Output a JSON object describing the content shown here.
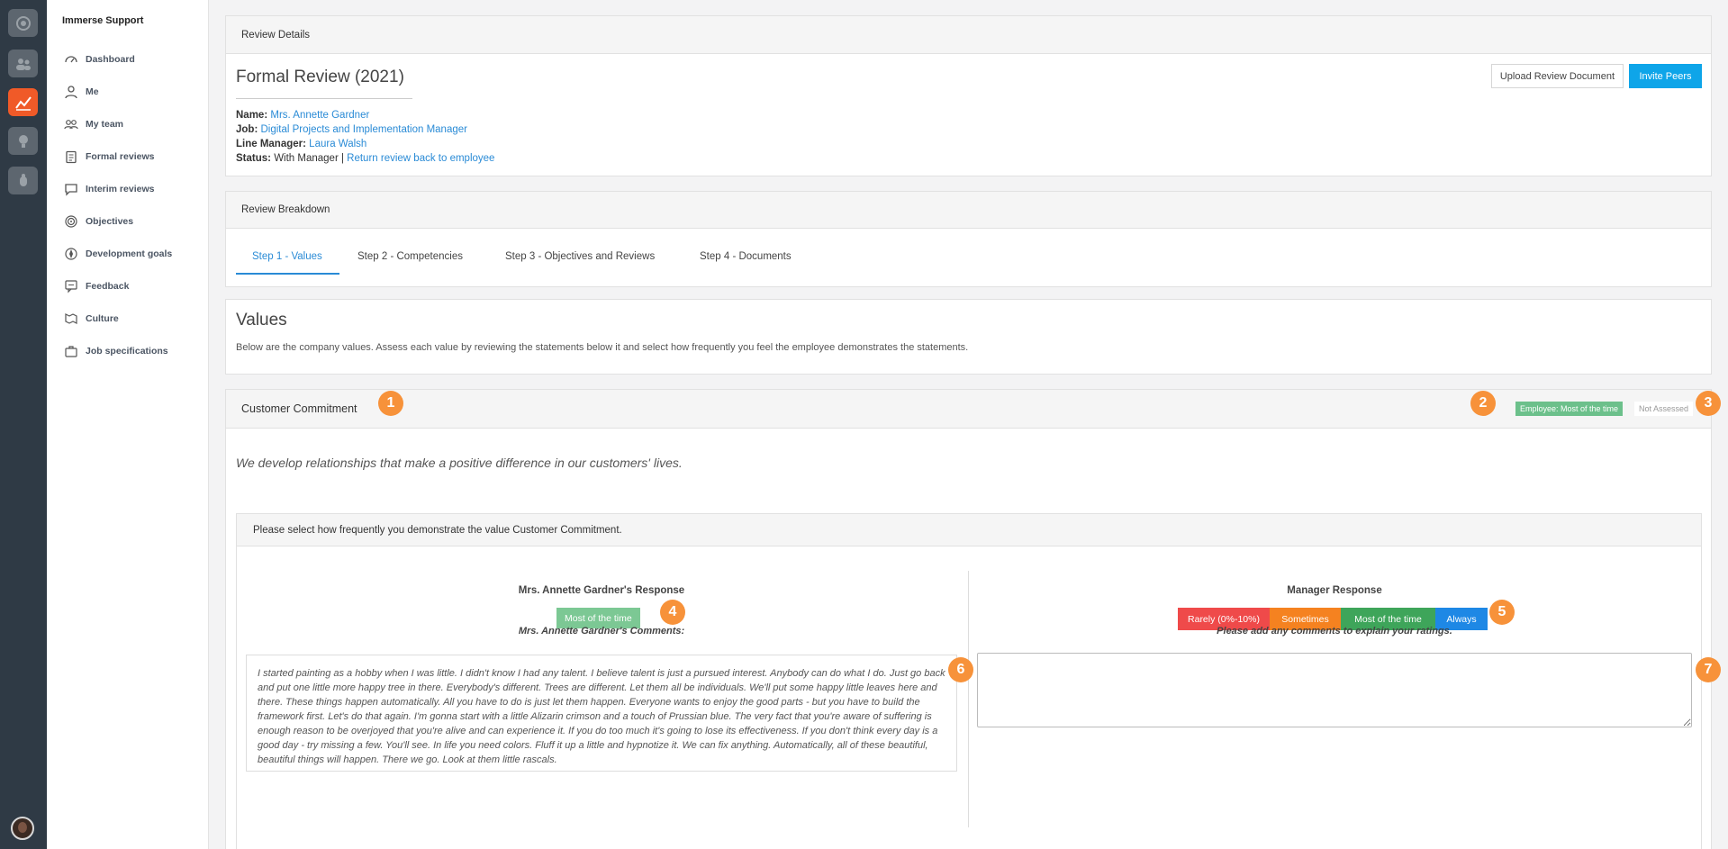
{
  "sidebar": {
    "brand": "Immerse Support",
    "items": [
      {
        "label": "Dashboard",
        "icon": "dashboard-icon"
      },
      {
        "label": "Me",
        "icon": "person-icon"
      },
      {
        "label": "My team",
        "icon": "team-icon"
      },
      {
        "label": "Formal reviews",
        "icon": "clipboard-icon"
      },
      {
        "label": "Interim reviews",
        "icon": "chat-icon"
      },
      {
        "label": "Objectives",
        "icon": "target-icon"
      },
      {
        "label": "Development goals",
        "icon": "compass-icon"
      },
      {
        "label": "Feedback",
        "icon": "feedback-icon"
      },
      {
        "label": "Culture",
        "icon": "culture-icon"
      },
      {
        "label": "Job specifications",
        "icon": "briefcase-icon"
      }
    ]
  },
  "review_details": {
    "header": "Review Details",
    "title": "Formal Review (2021)",
    "upload_label": "Upload Review Document",
    "invite_label": "Invite Peers",
    "name_label": "Name:",
    "name_value": "Mrs. Annette Gardner",
    "job_label": "Job:",
    "job_value": "Digital Projects and Implementation Manager",
    "manager_label": "Line Manager:",
    "manager_value": "Laura Walsh",
    "status_label": "Status:",
    "status_value": "With Manager |",
    "status_link": "Return review back to employee"
  },
  "breakdown": {
    "header": "Review Breakdown",
    "tabs": [
      {
        "label": "Step 1 - Values",
        "active": true
      },
      {
        "label": "Step 2 - Competencies",
        "active": false
      },
      {
        "label": "Step 3 - Objectives and Reviews",
        "active": false
      },
      {
        "label": "Step 4 - Documents",
        "active": false
      }
    ]
  },
  "values": {
    "title": "Values",
    "description": "Below are the company values. Assess each value by reviewing the statements below it and select how frequently you feel the employee demonstrates the statements."
  },
  "customer_commitment": {
    "title": "Customer Commitment",
    "employee_badge": "Employee: Most of the time",
    "manager_badge": "Not Assessed",
    "quote": "We develop relationships that make a positive difference in our customers' lives.",
    "prompt": "Please select how frequently you demonstrate the value Customer Commitment.",
    "employee_response_title": "Mrs. Annette Gardner's Response",
    "employee_response_value": "Most of the time",
    "employee_comments_title": "Mrs. Annette Gardner's Comments:",
    "employee_comment": "I started painting as a hobby when I was little. I didn't know I had any talent. I believe talent is just a pursued interest. Anybody can do what I do. Just go back and put one little more happy tree in there. Everybody's different. Trees are different. Let them all be individuals. We'll put some happy little leaves here and there. These things happen automatically. All you have to do is just let them happen. Everyone wants to enjoy the good parts - but you have to build the framework first. Let's do that again. I'm gonna start with a little Alizarin crimson and a touch of Prussian blue. The very fact that you're aware of suffering is enough reason to be overjoyed that you're alive and can experience it. If you do too much it's going to lose its effectiveness. If you don't think every day is a good day - try missing a few. You'll see. In life you need colors. Fluff it up a little and hypnotize it. We can fix anything. Automatically, all of these beautiful, beautiful things will happen. There we go. Look at them little rascals.",
    "manager_response_title": "Manager Response",
    "manager_options": [
      {
        "label": "Rarely (0%-10%)",
        "color": "#ef4a4a"
      },
      {
        "label": "Sometimes",
        "color": "#f58220"
      },
      {
        "label": "Most of the time",
        "color": "#3ea55a"
      },
      {
        "label": "Always",
        "color": "#1e88e5"
      }
    ],
    "manager_comments_title": "Please add any comments to explain your ratings.",
    "manager_comment": ""
  },
  "markers": [
    "1",
    "2",
    "3",
    "4",
    "5",
    "6",
    "7"
  ],
  "colors": {
    "accent": "#2a8bd6",
    "marker": "#f7923a",
    "rail": "#2f3a45",
    "active_rail": "#f05a28"
  }
}
